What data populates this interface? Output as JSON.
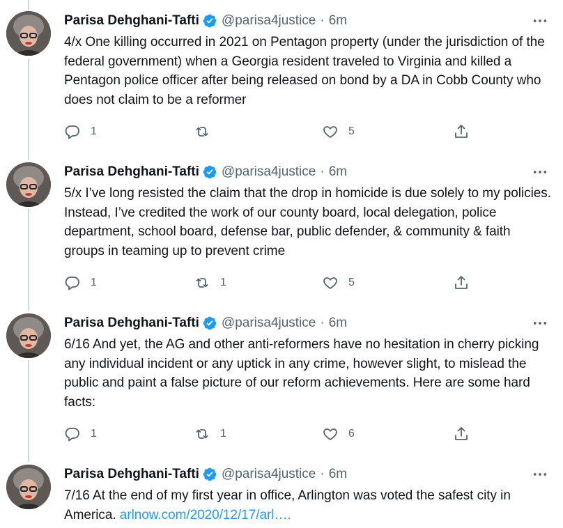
{
  "author": {
    "display_name": "Parisa Dehghani-Tafti",
    "handle": "@parisa4justice",
    "separator": "·",
    "time": "6m"
  },
  "tweets": [
    {
      "text": "4/x One killing occurred in 2021 on Pentagon property (under the jurisdiction of the federal government) when a Georgia resident traveled to Virginia and killed a Pentagon police officer after being released on bond by a DA in Cobb County who does not claim to be a reformer",
      "link": "",
      "replies": "1",
      "retweets": "",
      "likes": "5"
    },
    {
      "text": "5/x I’ve long resisted the claim that the drop in homicide is due solely to my policies. Instead, I’ve credited the work of our county board, local delegation, police department, school board, defense bar, public defender, & community & faith groups in teaming up to prevent crime",
      "link": "",
      "replies": "1",
      "retweets": "1",
      "likes": "5"
    },
    {
      "text": "6/16 And yet, the AG and other anti-reformers have no hesitation in cherry picking any individual incident or any uptick in any crime, however slight, to mislead the public and paint a false picture of our reform achievements. Here are some hard facts:",
      "link": "",
      "replies": "1",
      "retweets": "1",
      "likes": "6"
    },
    {
      "text": "7/16 At the end of my first year in office, Arlington was voted the safest city in America. ",
      "link": "arlnow.com/2020/12/17/arl….",
      "replies": "",
      "retweets": "",
      "likes": ""
    }
  ],
  "icons": {
    "verified": "verified-badge-icon",
    "more": "more-horizontal-icon",
    "reply": "reply-icon",
    "retweet": "retweet-icon",
    "like": "heart-icon",
    "share": "share-icon"
  },
  "colors": {
    "text": "#0f1419",
    "secondary": "#536471",
    "link": "#1d9bf0",
    "thread_line": "#cfd9de",
    "verified": "#1d9bf0"
  }
}
